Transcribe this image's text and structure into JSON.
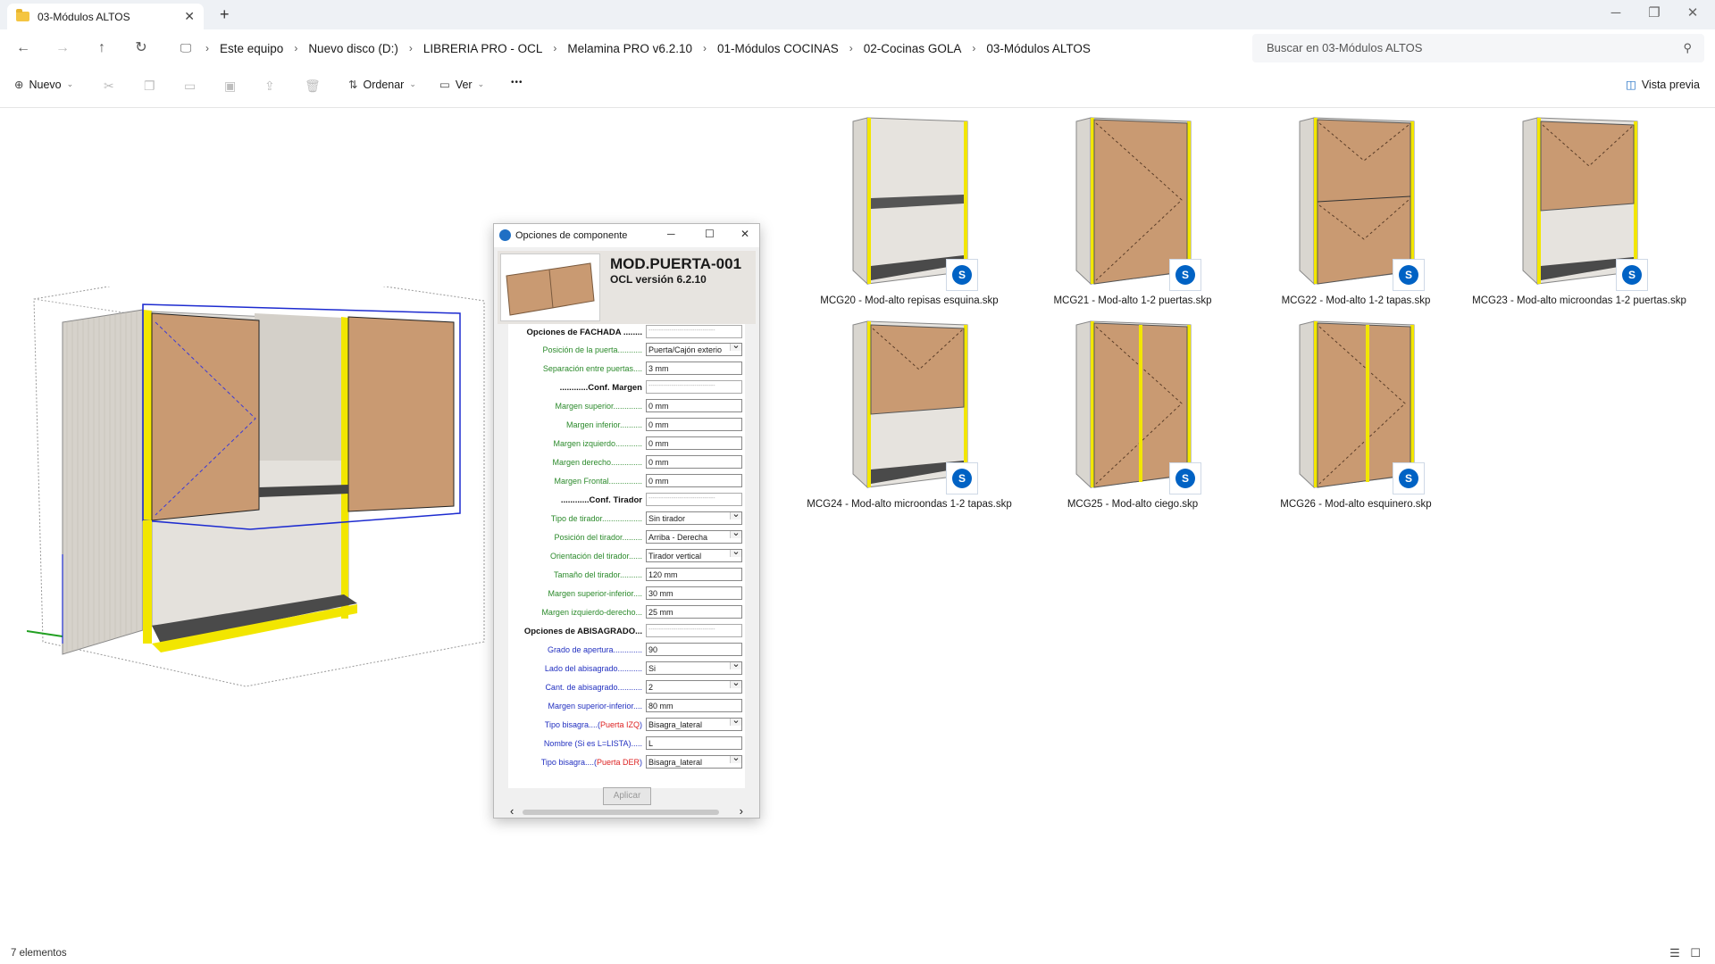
{
  "window": {
    "tab_title": "03-Módulos ALTOS",
    "new_tab": "+",
    "close_tab": "✕",
    "minimize": "─",
    "maximize": "❐",
    "close": "✕"
  },
  "breadcrumb": [
    "Este equipo",
    "Nuevo disco (D:)",
    "LIBRERIA PRO - OCL",
    "Melamina PRO v6.2.10",
    "01-Módulos COCINAS",
    "02-Cocinas GOLA",
    "03-Módulos ALTOS"
  ],
  "search": {
    "placeholder": "Buscar en 03-Módulos ALTOS"
  },
  "toolbar": {
    "new_label": "Nuevo",
    "sort_label": "Ordenar",
    "view_label": "Ver",
    "more_label": "•••",
    "preview_label": "Vista previa"
  },
  "files": [
    {
      "name": "MCG20 - Mod-alto repisas esquina.skp",
      "icon": "sketchup-icon"
    },
    {
      "name": "MCG21 - Mod-alto 1-2 puertas.skp",
      "icon": "sketchup-icon"
    },
    {
      "name": "MCG22 - Mod-alto 1-2 tapas.skp",
      "icon": "sketchup-icon"
    },
    {
      "name": "MCG23 - Mod-alto microondas 1-2 puertas.skp",
      "icon": "sketchup-icon"
    },
    {
      "name": "MCG24 - Mod-alto microondas 1-2 tapas.skp",
      "icon": "sketchup-icon"
    },
    {
      "name": "MCG25 - Mod-alto ciego.skp",
      "icon": "sketchup-icon"
    },
    {
      "name": "MCG26 - Mod-alto esquinero.skp",
      "icon": "sketchup-icon"
    }
  ],
  "dialog": {
    "title": "Opciones de componente",
    "heading": "MOD.PUERTA-001",
    "version": "OCL versión 6.2.10",
    "apply": "Aplicar",
    "rows": [
      {
        "label": "Opciones de FACHADA ........",
        "value": "--------------------------------",
        "kind": "section"
      },
      {
        "label": "Posición de la puerta...........",
        "value": "Puerta/Cajón exterio",
        "kind": "g",
        "sel": true
      },
      {
        "label": "Separación entre puertas....",
        "value": "3 mm",
        "kind": "g"
      },
      {
        "label": "............Conf. Margen",
        "value": "--------------------------------",
        "kind": "section"
      },
      {
        "label": "Margen superior.............",
        "value": "0 mm",
        "kind": "g"
      },
      {
        "label": "Margen inferior..........",
        "value": "0 mm",
        "kind": "g"
      },
      {
        "label": "Margen izquierdo............",
        "value": "0 mm",
        "kind": "g"
      },
      {
        "label": "Margen derecho..............",
        "value": "0 mm",
        "kind": "g"
      },
      {
        "label": "Margen Frontal...............",
        "value": "0 mm",
        "kind": "g"
      },
      {
        "label": "............Conf. Tirador",
        "value": "--------------------------------",
        "kind": "section"
      },
      {
        "label": "Tipo de tirador..................",
        "value": "Sin tirador",
        "kind": "g",
        "sel": true
      },
      {
        "label": "Posición del tirador.........",
        "value": "Arriba - Derecha",
        "kind": "g",
        "sel": true
      },
      {
        "label": "Orientación del tirador......",
        "value": "Tirador vertical",
        "kind": "g",
        "sel": true
      },
      {
        "label": "Tamaño del tirador..........",
        "value": "120 mm",
        "kind": "g"
      },
      {
        "label": "Margen superior-inferior....",
        "value": "30 mm",
        "kind": "g"
      },
      {
        "label": "Margen izquierdo-derecho...",
        "value": "25 mm",
        "kind": "g"
      },
      {
        "label": "Opciones de ABISAGRADO...",
        "value": "--------------------------------",
        "kind": "section"
      },
      {
        "label": "Grado de apertura.............",
        "value": "90",
        "kind": "bl"
      },
      {
        "label": "Lado del abisagrado...........",
        "value": "Si",
        "kind": "bl",
        "sel": true
      },
      {
        "label": "Cant. de abisagrado...........",
        "value": "2",
        "kind": "bl",
        "sel": true
      },
      {
        "label": "Margen superior-inferior....",
        "value": "80 mm",
        "kind": "bl"
      },
      {
        "label": "Tipo bisagra....(",
        "red": "Puerta IZQ",
        "tail": ")",
        "value": "Bisagra_lateral",
        "kind": "bl",
        "sel": true
      },
      {
        "label": "Nombre (Si es L=LISTA).....",
        "value": "L",
        "kind": "bl"
      },
      {
        "label": "Tipo bisagra....(",
        "red": "Puerta DER",
        "tail": ")",
        "value": "Bisagra_lateral",
        "kind": "bl",
        "sel": true
      }
    ]
  },
  "status": {
    "count": "7 elementos"
  },
  "colors": {
    "accent": "#0062c4",
    "wood": "#c9966d",
    "panel": "#d9d6d0",
    "edge": "#f2e600",
    "selection": "#1d2bd0"
  }
}
